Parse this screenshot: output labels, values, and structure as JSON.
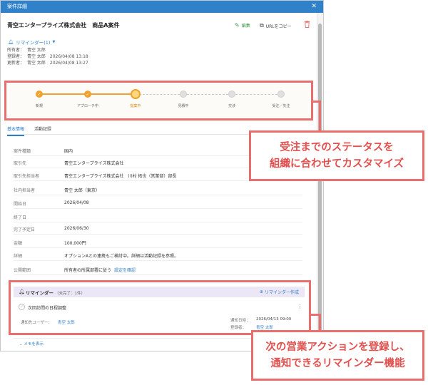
{
  "modal": {
    "title": "案件詳細",
    "close_glyph": "✕"
  },
  "header": {
    "deal_title": "青空エンタープライズ株式会社　商品A案件",
    "edit_label": "編集",
    "copy_url_label": "URLをコピー",
    "reminder_toggle_label": "リマインダー(1)",
    "meta": [
      {
        "key": "所有者：",
        "value": "青空 太郎"
      },
      {
        "key": "登録者：",
        "value": "青空 太郎　2026/04/08 13:18"
      },
      {
        "key": "更新者：",
        "value": "青空 太郎　2026/04/08 13:27"
      }
    ]
  },
  "status": {
    "stages": [
      "新規",
      "アプローチ中",
      "提案中",
      "見積中",
      "交渉",
      "受注／失注"
    ],
    "current_index": 2
  },
  "tabs": [
    "基本情報",
    "活動記録"
  ],
  "fields": [
    {
      "key": "案件種類",
      "value": "国内"
    },
    {
      "key": "取引先",
      "value": "青空エンタープライズ株式会社",
      "link": true
    },
    {
      "key": "取引先担当者",
      "value": "青空エンタープライズ株式会社　川村 拓也（営業部）部長",
      "link": true
    },
    {
      "key": "社内担当者",
      "value": "青空 太郎（東京）"
    },
    {
      "key": "開始日",
      "value": "2026/04/08"
    },
    {
      "key": "終了日",
      "value": ""
    },
    {
      "key": "完了予定日",
      "value": "2026/06/30"
    },
    {
      "key": "金額",
      "value": "100,000円"
    },
    {
      "key": "詳細",
      "value": "オプションAとの連携もご検討中。詳細は活動記録を参照。"
    },
    {
      "key": "公開範囲",
      "value": "所有者の所属部署に従う",
      "extra": "設定を確認"
    }
  ],
  "reminders": {
    "title": "リマインダー",
    "subtitle": "（未完了：1件）",
    "create_label": "リマインダー作成",
    "item": {
      "name": "次回訪問の日程調整",
      "notify_user_label": "通知先ユーザー：",
      "notify_user": "青空 太郎",
      "notify_date_label": "通知日時：",
      "notify_date": "2026/04/13 09:00",
      "registrant_label": "登録者：",
      "registrant": "青空 太郎"
    },
    "memo_label": "メモを表示"
  },
  "callouts": {
    "status": [
      "受注までのステータスを",
      "組織に合わせてカスタマイズ"
    ],
    "reminder": [
      "次の営業アクションを登録し、",
      "通知できるリマインダー機能"
    ]
  },
  "colors": {
    "titlebar": "#2f82c9",
    "accent": "#f0a22c",
    "callout": "#e96e6e",
    "link": "#2d7fc6",
    "reminder_header_bg": "#ece7f6"
  }
}
